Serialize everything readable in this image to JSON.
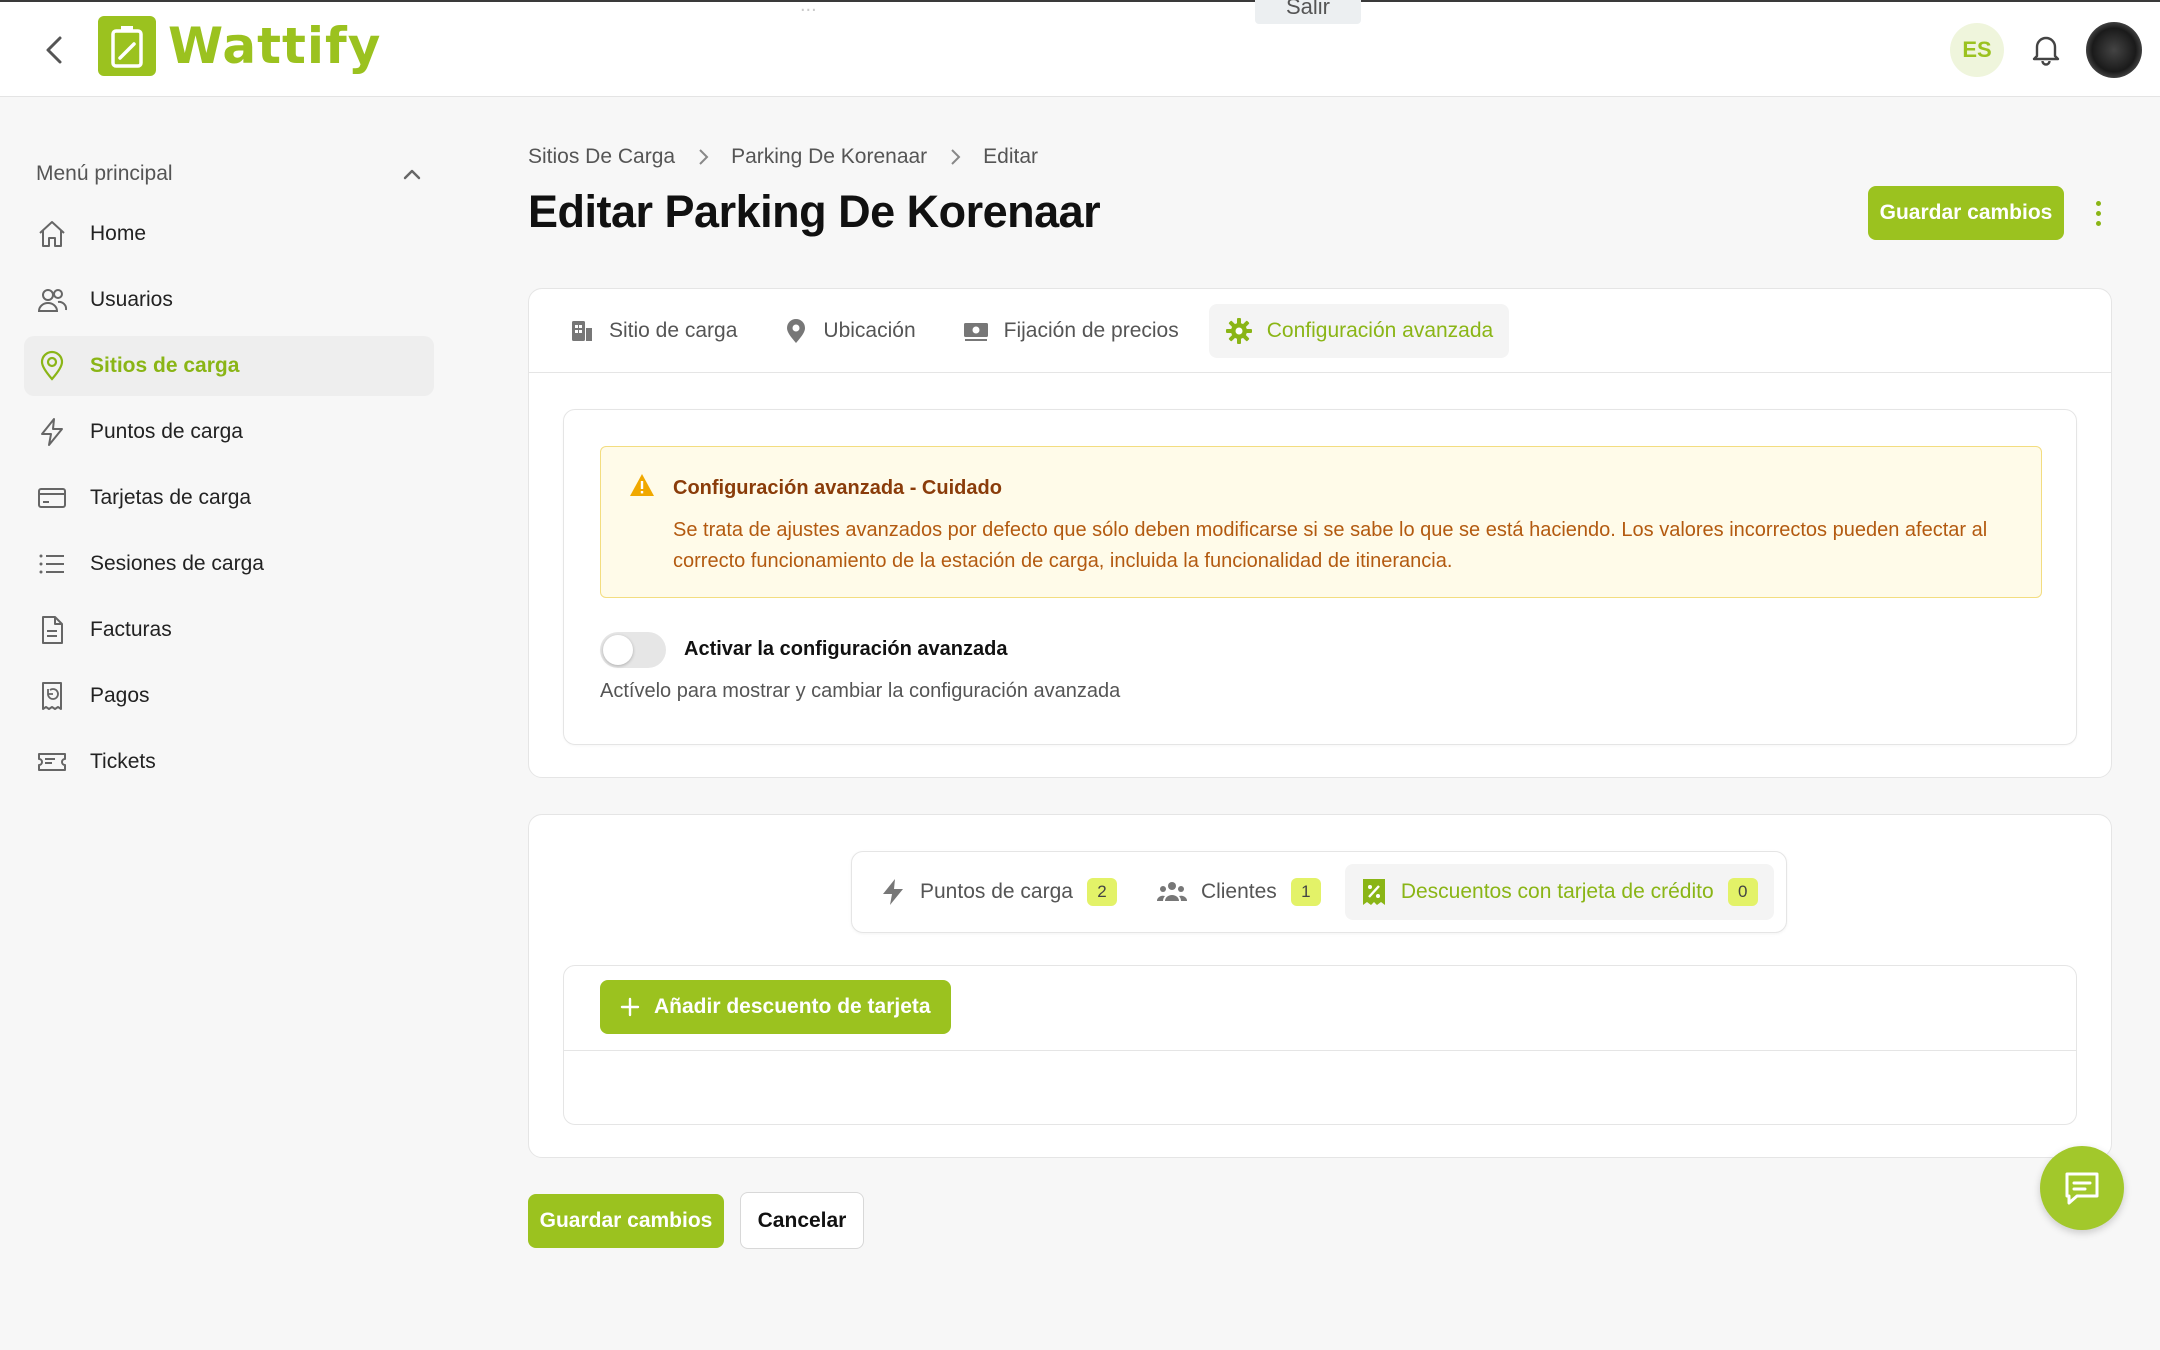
{
  "header": {
    "app_name": "Wattify",
    "ghost_text": "...",
    "ghost_button": "Salir",
    "language": "ES"
  },
  "sidebar": {
    "section_title": "Menú principal",
    "items": [
      {
        "label": "Home",
        "icon": "home-icon"
      },
      {
        "label": "Usuarios",
        "icon": "users-icon"
      },
      {
        "label": "Sitios de carga",
        "icon": "map-pin-icon",
        "active": true
      },
      {
        "label": "Puntos de carga",
        "icon": "bolt-icon"
      },
      {
        "label": "Tarjetas de carga",
        "icon": "credit-card-icon"
      },
      {
        "label": "Sesiones de carga",
        "icon": "list-icon"
      },
      {
        "label": "Facturas",
        "icon": "document-icon"
      },
      {
        "label": "Pagos",
        "icon": "receipt-icon"
      },
      {
        "label": "Tickets",
        "icon": "ticket-icon"
      }
    ]
  },
  "breadcrumb": [
    "Sitios De Carga",
    "Parking De Korenaar",
    "Editar"
  ],
  "page_title": "Editar Parking De Korenaar",
  "actions": {
    "save": "Guardar cambios",
    "cancel": "Cancelar"
  },
  "tabs": [
    {
      "label": "Sitio de carga",
      "icon": "building-icon"
    },
    {
      "label": "Ubicación",
      "icon": "location-icon"
    },
    {
      "label": "Fijación de precios",
      "icon": "money-icon"
    },
    {
      "label": "Configuración avanzada",
      "icon": "gear-icon",
      "active": true
    }
  ],
  "warning": {
    "title": "Configuración avanzada - Cuidado",
    "text": "Se trata de ajustes avanzados por defecto que sólo deben modificarse si se sabe lo que se está haciendo. Los valores incorrectos pueden afectar al correcto funcionamiento de la estación de carga, incluida la funcionalidad de itinerancia."
  },
  "advanced_toggle": {
    "label": "Activar la configuración avanzada",
    "help": "Actívelo para mostrar y cambiar la configuración avanzada",
    "enabled": false
  },
  "subtabs": [
    {
      "label": "Puntos de carga",
      "count": "2",
      "icon": "bolt-icon"
    },
    {
      "label": "Clientes",
      "count": "1",
      "icon": "group-icon"
    },
    {
      "label": "Descuentos con tarjeta de crédito",
      "count": "0",
      "icon": "discount-icon",
      "active": true
    }
  ],
  "add_discount_label": "Añadir descuento de tarjeta",
  "colors": {
    "accent": "#9bc21f",
    "warning_bg": "#fffbe9",
    "warning_text": "#b35a10"
  }
}
